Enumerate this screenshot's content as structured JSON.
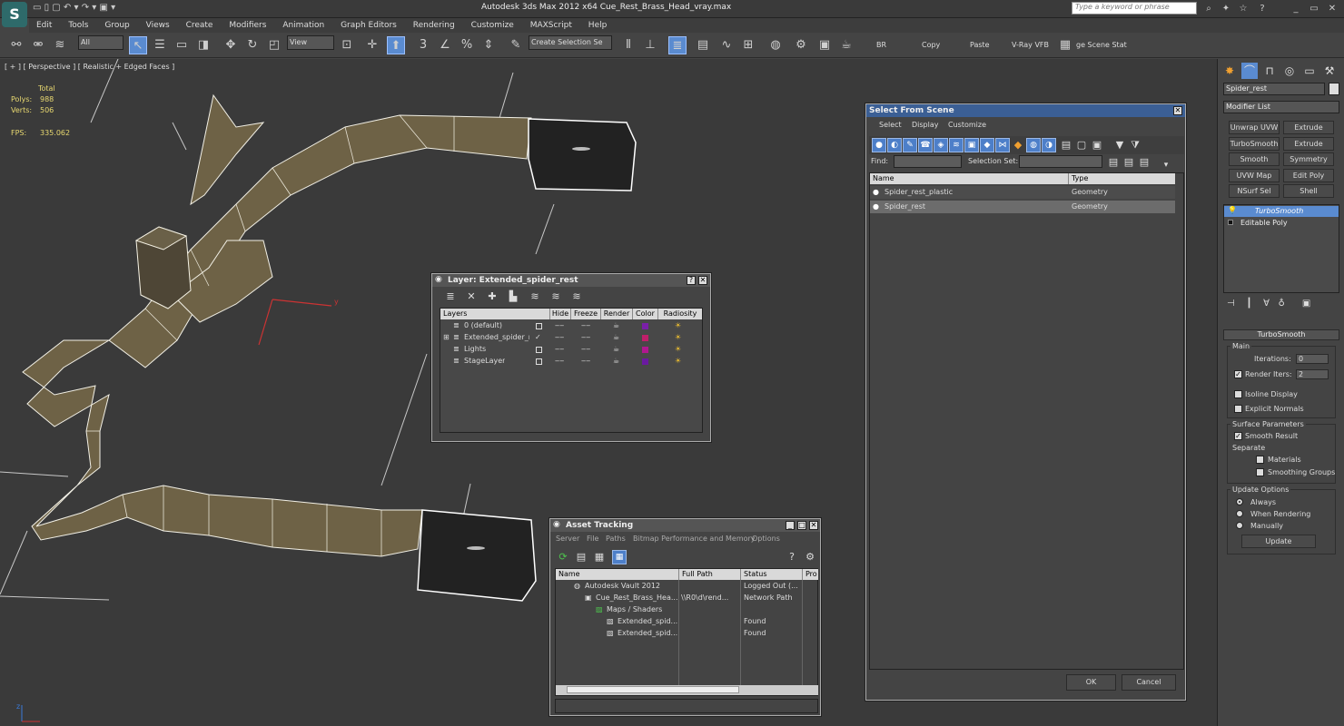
{
  "app": {
    "title": "Autodesk 3ds Max  2012 x64     Cue_Rest_Brass_Head_vray.max",
    "logo_letter": "S",
    "search_placeholder": "Type a keyword or phrase"
  },
  "menu": [
    "Edit",
    "Tools",
    "Group",
    "Views",
    "Create",
    "Modifiers",
    "Animation",
    "Graph Editors",
    "Rendering",
    "Customize",
    "MAXScript",
    "Help"
  ],
  "toolbar": {
    "selection_filter": "All",
    "reference_coord": "View",
    "named_selection_placeholder": "Create Selection Se",
    "buttons": [
      "BR",
      "Copy",
      "Paste",
      "V-Ray VFB",
      "ge Scene Stat"
    ]
  },
  "viewport": {
    "label": "[ + ] [ Perspective ] [ Realistic + Edged Faces ]",
    "stats": {
      "header": "Total",
      "polys_label": "Polys:",
      "polys": "988",
      "verts_label": "Verts:",
      "verts": "506",
      "fps_label": "FPS:",
      "fps": "335.062"
    },
    "axis": {
      "y": "y",
      "z": "z"
    }
  },
  "command_panel": {
    "object_name": "Spider_rest",
    "modifier_list": "Modifier List",
    "modifier_buttons": [
      "Unwrap UVW",
      "Extrude",
      "TurboSmooth",
      "Extrude",
      "Smooth",
      "Symmetry",
      "UVW Map",
      "Edit Poly",
      "NSurf Sel",
      "Shell"
    ],
    "stack": [
      "TurboSmooth",
      "Editable Poly"
    ],
    "rollout": "TurboSmooth",
    "main_label": "Main",
    "iterations_label": "Iterations:",
    "iterations": "0",
    "render_iters_label": "Render Iters:",
    "render_iters": "2",
    "isoline_label": "Isoline Display",
    "explicit_label": "Explicit Normals",
    "surface_label": "Surface Parameters",
    "smooth_result_label": "Smooth Result",
    "separate_label": "Separate",
    "materials_label": "Materials",
    "smoothing_groups_label": "Smoothing Groups",
    "update_options_label": "Update Options",
    "always_label": "Always",
    "when_rendering_label": "When Rendering",
    "manually_label": "Manually",
    "update_button": "Update"
  },
  "layer_dialog": {
    "title": "Layer: Extended_spider_rest",
    "columns": [
      "Layers",
      "Hide",
      "Freeze",
      "Render",
      "Color",
      "Radiosity"
    ],
    "rows": [
      {
        "name": "0 (default)",
        "color": "#7a1fa8"
      },
      {
        "name": "Extended_spider_re",
        "color": "#c01f6a"
      },
      {
        "name": "Lights",
        "color": "#b0188f"
      },
      {
        "name": "StageLayer",
        "color": "#6a1aa0"
      }
    ]
  },
  "select_dialog": {
    "title": "Select From Scene",
    "menu": [
      "Select",
      "Display",
      "Customize"
    ],
    "find_label": "Find:",
    "selection_set_label": "Selection Set:",
    "columns": [
      "Name",
      "Type"
    ],
    "rows": [
      {
        "name": "Spider_rest_plastic",
        "type": "Geometry"
      },
      {
        "name": "Spider_rest",
        "type": "Geometry"
      }
    ],
    "ok": "OK",
    "cancel": "Cancel"
  },
  "asset_dialog": {
    "title": "Asset Tracking",
    "menu": [
      "Server",
      "File",
      "Paths",
      "Bitmap Performance and Memory",
      "Options"
    ],
    "columns": [
      "Name",
      "Full Path",
      "Status",
      "Pro"
    ],
    "rows": [
      {
        "name": "Autodesk Vault 2012",
        "path": "",
        "status": "Logged Out (..."
      },
      {
        "name": "Cue_Rest_Brass_Hea...",
        "path": "\\\\R0\\d\\rend...",
        "status": "Network Path"
      },
      {
        "name": "Maps / Shaders",
        "path": "",
        "status": ""
      },
      {
        "name": "Extended_spid...",
        "path": "",
        "status": "Found"
      },
      {
        "name": "Extended_spid...",
        "path": "",
        "status": "Found"
      }
    ]
  }
}
